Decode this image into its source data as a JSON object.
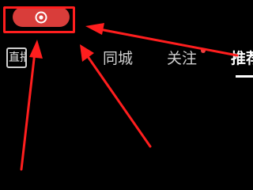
{
  "top_bar": {
    "record_button_icon": "record-icon",
    "accent_color": "#d93d3a"
  },
  "tabs": {
    "live_icon_text": "直播",
    "city_label": "同城",
    "follow_label": "关注",
    "recommend_label": "推荐"
  },
  "annotation": {
    "highlight_color": "#ff1e1e",
    "arrow_color": "#ff1e1e"
  }
}
